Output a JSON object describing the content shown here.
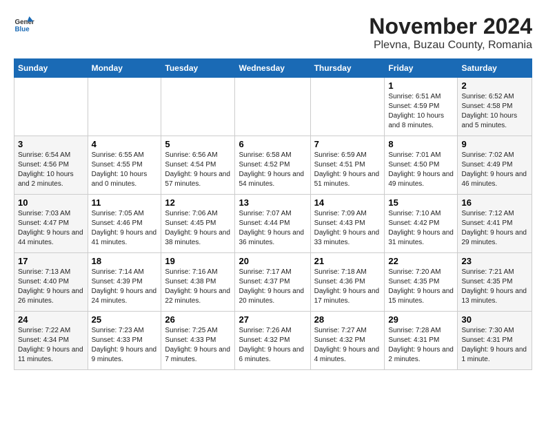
{
  "logo": {
    "general": "General",
    "blue": "Blue"
  },
  "title": "November 2024",
  "subtitle": "Plevna, Buzau County, Romania",
  "days_of_week": [
    "Sunday",
    "Monday",
    "Tuesday",
    "Wednesday",
    "Thursday",
    "Friday",
    "Saturday"
  ],
  "weeks": [
    [
      {
        "day": "",
        "info": ""
      },
      {
        "day": "",
        "info": ""
      },
      {
        "day": "",
        "info": ""
      },
      {
        "day": "",
        "info": ""
      },
      {
        "day": "",
        "info": ""
      },
      {
        "day": "1",
        "info": "Sunrise: 6:51 AM\nSunset: 4:59 PM\nDaylight: 10 hours and 8 minutes."
      },
      {
        "day": "2",
        "info": "Sunrise: 6:52 AM\nSunset: 4:58 PM\nDaylight: 10 hours and 5 minutes."
      }
    ],
    [
      {
        "day": "3",
        "info": "Sunrise: 6:54 AM\nSunset: 4:56 PM\nDaylight: 10 hours and 2 minutes."
      },
      {
        "day": "4",
        "info": "Sunrise: 6:55 AM\nSunset: 4:55 PM\nDaylight: 10 hours and 0 minutes."
      },
      {
        "day": "5",
        "info": "Sunrise: 6:56 AM\nSunset: 4:54 PM\nDaylight: 9 hours and 57 minutes."
      },
      {
        "day": "6",
        "info": "Sunrise: 6:58 AM\nSunset: 4:52 PM\nDaylight: 9 hours and 54 minutes."
      },
      {
        "day": "7",
        "info": "Sunrise: 6:59 AM\nSunset: 4:51 PM\nDaylight: 9 hours and 51 minutes."
      },
      {
        "day": "8",
        "info": "Sunrise: 7:01 AM\nSunset: 4:50 PM\nDaylight: 9 hours and 49 minutes."
      },
      {
        "day": "9",
        "info": "Sunrise: 7:02 AM\nSunset: 4:49 PM\nDaylight: 9 hours and 46 minutes."
      }
    ],
    [
      {
        "day": "10",
        "info": "Sunrise: 7:03 AM\nSunset: 4:47 PM\nDaylight: 9 hours and 44 minutes."
      },
      {
        "day": "11",
        "info": "Sunrise: 7:05 AM\nSunset: 4:46 PM\nDaylight: 9 hours and 41 minutes."
      },
      {
        "day": "12",
        "info": "Sunrise: 7:06 AM\nSunset: 4:45 PM\nDaylight: 9 hours and 38 minutes."
      },
      {
        "day": "13",
        "info": "Sunrise: 7:07 AM\nSunset: 4:44 PM\nDaylight: 9 hours and 36 minutes."
      },
      {
        "day": "14",
        "info": "Sunrise: 7:09 AM\nSunset: 4:43 PM\nDaylight: 9 hours and 33 minutes."
      },
      {
        "day": "15",
        "info": "Sunrise: 7:10 AM\nSunset: 4:42 PM\nDaylight: 9 hours and 31 minutes."
      },
      {
        "day": "16",
        "info": "Sunrise: 7:12 AM\nSunset: 4:41 PM\nDaylight: 9 hours and 29 minutes."
      }
    ],
    [
      {
        "day": "17",
        "info": "Sunrise: 7:13 AM\nSunset: 4:40 PM\nDaylight: 9 hours and 26 minutes."
      },
      {
        "day": "18",
        "info": "Sunrise: 7:14 AM\nSunset: 4:39 PM\nDaylight: 9 hours and 24 minutes."
      },
      {
        "day": "19",
        "info": "Sunrise: 7:16 AM\nSunset: 4:38 PM\nDaylight: 9 hours and 22 minutes."
      },
      {
        "day": "20",
        "info": "Sunrise: 7:17 AM\nSunset: 4:37 PM\nDaylight: 9 hours and 20 minutes."
      },
      {
        "day": "21",
        "info": "Sunrise: 7:18 AM\nSunset: 4:36 PM\nDaylight: 9 hours and 17 minutes."
      },
      {
        "day": "22",
        "info": "Sunrise: 7:20 AM\nSunset: 4:35 PM\nDaylight: 9 hours and 15 minutes."
      },
      {
        "day": "23",
        "info": "Sunrise: 7:21 AM\nSunset: 4:35 PM\nDaylight: 9 hours and 13 minutes."
      }
    ],
    [
      {
        "day": "24",
        "info": "Sunrise: 7:22 AM\nSunset: 4:34 PM\nDaylight: 9 hours and 11 minutes."
      },
      {
        "day": "25",
        "info": "Sunrise: 7:23 AM\nSunset: 4:33 PM\nDaylight: 9 hours and 9 minutes."
      },
      {
        "day": "26",
        "info": "Sunrise: 7:25 AM\nSunset: 4:33 PM\nDaylight: 9 hours and 7 minutes."
      },
      {
        "day": "27",
        "info": "Sunrise: 7:26 AM\nSunset: 4:32 PM\nDaylight: 9 hours and 6 minutes."
      },
      {
        "day": "28",
        "info": "Sunrise: 7:27 AM\nSunset: 4:32 PM\nDaylight: 9 hours and 4 minutes."
      },
      {
        "day": "29",
        "info": "Sunrise: 7:28 AM\nSunset: 4:31 PM\nDaylight: 9 hours and 2 minutes."
      },
      {
        "day": "30",
        "info": "Sunrise: 7:30 AM\nSunset: 4:31 PM\nDaylight: 9 hours and 1 minute."
      }
    ]
  ]
}
